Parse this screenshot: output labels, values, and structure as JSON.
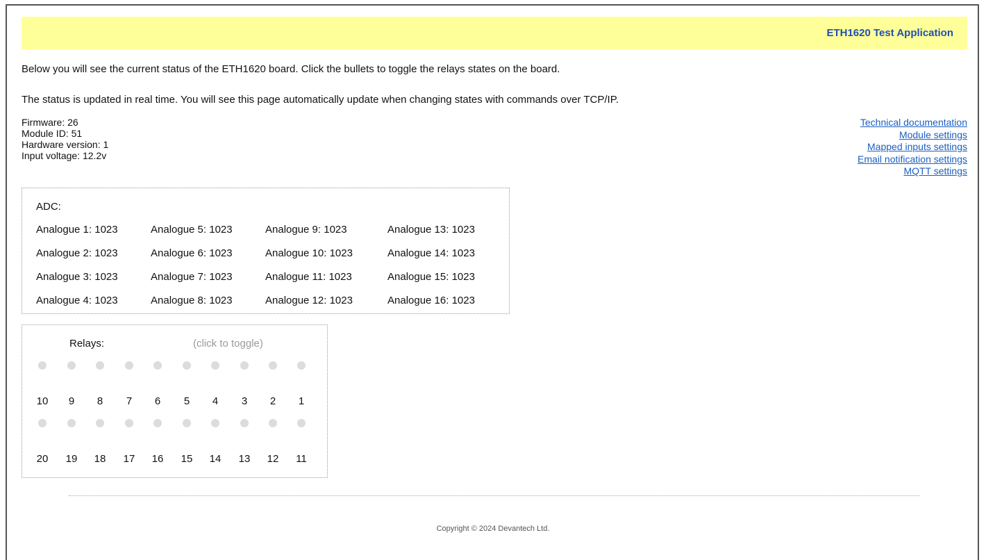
{
  "header": {
    "title": "ETH1620 Test Application"
  },
  "intro": {
    "line1": "Below you will see the current status of the ETH1620 board. Click the bullets to toggle the relays states on the board.",
    "line2": "The status is updated in real time. You will see this page automatically update when changing states with commands over TCP/IP."
  },
  "info": {
    "firmware": "Firmware: 26",
    "module_id": "Module ID: 51",
    "hardware_version": "Hardware version: 1",
    "input_voltage": "Input voltage: 12.2v"
  },
  "links": [
    "Technical documentation",
    "Module settings",
    "Mapped inputs settings",
    "Email notification settings",
    "MQTT settings"
  ],
  "adc": {
    "title": "ADC:",
    "rows": [
      [
        "Analogue 1: 1023",
        "Analogue 5: 1023",
        "Analogue 9: 1023",
        "Analogue 13: 1023"
      ],
      [
        "Analogue 2: 1023",
        "Analogue 6: 1023",
        "Analogue 10: 1023",
        "Analogue 14: 1023"
      ],
      [
        "Analogue 3: 1023",
        "Analogue 7: 1023",
        "Analogue 11: 1023",
        "Analogue 15: 1023"
      ],
      [
        "Analogue 4: 1023",
        "Analogue 8: 1023",
        "Analogue 12: 1023",
        "Analogue 16: 1023"
      ]
    ]
  },
  "relays": {
    "title": "Relays:",
    "hint": "(click to toggle)",
    "row1": [
      "10",
      "9",
      "8",
      "7",
      "6",
      "5",
      "4",
      "3",
      "2",
      "1"
    ],
    "row2": [
      "20",
      "19",
      "18",
      "17",
      "16",
      "15",
      "14",
      "13",
      "12",
      "11"
    ],
    "bullet_color_off": "#dcdcdc"
  },
  "footer": {
    "copyright": "Copyright © 2024 Devantech Ltd."
  }
}
